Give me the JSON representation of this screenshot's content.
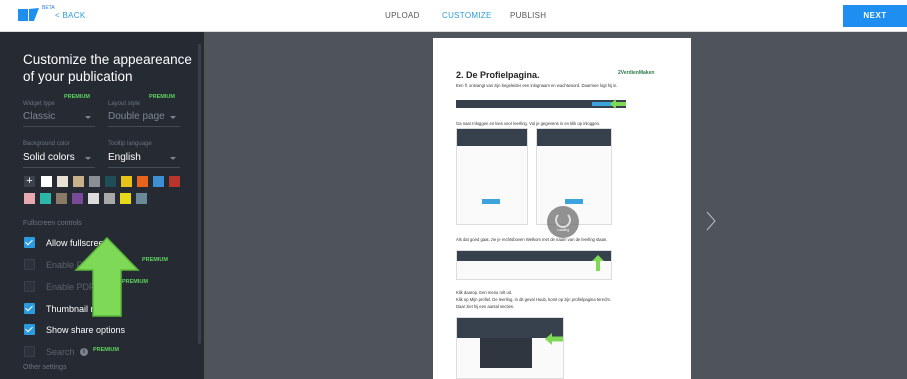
{
  "header": {
    "logo_beta": "BETA",
    "back_label": "< BACK",
    "tabs": [
      {
        "label": "UPLOAD"
      },
      {
        "label": "CUSTOMIZE"
      },
      {
        "label": "PUBLISH"
      }
    ],
    "active_tab": "CUSTOMIZE",
    "next_label": "NEXT"
  },
  "sidebar": {
    "title": "Customize the appeareance of your publication",
    "widget_type": {
      "label": "Widget type",
      "badge": "PREMIUM",
      "value": "Classic"
    },
    "layout_style": {
      "label": "Layout style",
      "badge": "PREMIUM",
      "value": "Double page"
    },
    "background_color": {
      "label": "Background color",
      "value": "Solid colors"
    },
    "tooltip_language": {
      "label": "Tooltip language",
      "value": "English"
    },
    "swatches_row1": [
      "#ffffff",
      "#e8e2d6",
      "#c8b08a",
      "#8a8f96",
      "#1f4d5a",
      "#e8c31a",
      "#e8641a",
      "#3d8fd4",
      "#b8352c"
    ],
    "swatches_row2": [
      "#e8a8b0",
      "#2bb8a8",
      "#8a7a68",
      "#7a4a9a",
      "#dcdcdc",
      "#a8a8a8",
      "#e8d81a",
      "#6a8a9a"
    ],
    "fullscreen_section": "Fullscreen controls",
    "options": [
      {
        "label": "Allow fullscreen",
        "checked": true,
        "enabled": true
      },
      {
        "label": "Enable PDF",
        "checked": false,
        "enabled": false,
        "badge": "PREMIUM"
      },
      {
        "label": "Enable PDF",
        "checked": false,
        "enabled": false,
        "badge": "PREMIUM"
      },
      {
        "label": "Thumbnail n",
        "checked": true,
        "enabled": true
      },
      {
        "label": "Show share options",
        "checked": true,
        "enabled": true
      },
      {
        "label": "Search",
        "checked": false,
        "enabled": false,
        "badge": "PREMIUM"
      }
    ],
    "other_section": "Other settings",
    "accent": "#2b9be0",
    "premium_color": "#5dd35d"
  },
  "preview": {
    "heading": "2. De Profielpagina.",
    "logo_text": "2VerdienMaken",
    "lines": [
      "Een fl. ontvangt van zijn begeleider een inlognaam en wachtwoord. Daarmee logt hij in.",
      "Ga naar Inloggen en kies voor leerling. Vul je gegevens in en klik op inloggen.",
      "Als dat goed gaat, zie je rechtsboven Welkom met de naam van de leerling staan.",
      "Klik daarop. Een menu rolt uit.",
      "Klik op Mijn profiel. De leerling, in dit geval Huub, komt op zijn profielpagina terecht.",
      "Daar ziet hij een aantal secties."
    ],
    "loading_label": "Loading",
    "next_page_icon": "chevron-right-icon"
  }
}
